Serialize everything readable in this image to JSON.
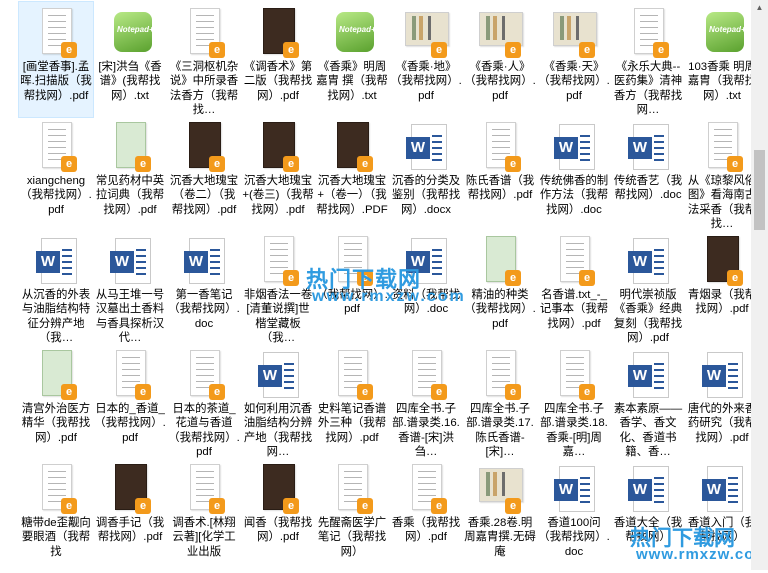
{
  "files": [
    [
      {
        "label": "[画堂香事].孟晖.扫描版（我帮找网）.pdf",
        "kind": "pdf",
        "selected": true
      },
      {
        "label": "[宋]洪刍《香谱》(我帮找网）.txt",
        "kind": "txt"
      },
      {
        "label": "《三洞枢机杂说》中所录香法香方（我帮找…",
        "kind": "pdf"
      },
      {
        "label": "《调香术》第二版（我帮找网）.pdf",
        "kind": "pdf-dark"
      },
      {
        "label": "《香乘》明周嘉胄 撰（我帮找网）.txt",
        "kind": "txt"
      },
      {
        "label": "《香乘·地》（我帮找网）.pdf",
        "kind": "pdf-book"
      },
      {
        "label": "《香乘·人》（我帮找网）.pdf",
        "kind": "pdf-book"
      },
      {
        "label": "《香乘·天》（我帮找网）.pdf",
        "kind": "pdf-book"
      },
      {
        "label": "《永乐大典--医药集》清神香方（我帮找网…",
        "kind": "pdf"
      },
      {
        "label": "103香乘 明周嘉胄（我帮找网）.txt",
        "kind": "txt"
      }
    ],
    [
      {
        "label": "xiangcheng（我帮找网）.pdf",
        "kind": "pdf"
      },
      {
        "label": "常见药材中英拉词典（我帮找网）.pdf",
        "kind": "pdf-green"
      },
      {
        "label": "沉香大地瑰宝（卷二）（我帮找网）.pdf",
        "kind": "pdf-dark"
      },
      {
        "label": "沉香大地瑰宝+(卷三)（我帮找网）.pdf",
        "kind": "pdf-dark"
      },
      {
        "label": "沉香大地瑰宝+（卷一）（我帮找网）.PDF",
        "kind": "pdf-dark"
      },
      {
        "label": "沉香的分类及鉴别（我帮找网）.docx",
        "kind": "word"
      },
      {
        "label": "陈氏香谱（我帮找网）.pdf",
        "kind": "pdf"
      },
      {
        "label": "传统佛香的制作方法（我帮找网）.doc",
        "kind": "word"
      },
      {
        "label": "传统香艺（我帮找网）.doc",
        "kind": "word"
      },
      {
        "label": "从《琼黎风俗图》看海南古法采香（我帮找…",
        "kind": "pdf"
      }
    ],
    [
      {
        "label": "从沉香的外表与油脂结构特征分辨产地（我…",
        "kind": "word"
      },
      {
        "label": "从马王堆一号汉墓出土香料与香具探析汉代…",
        "kind": "word"
      },
      {
        "label": "第一香笔记（我帮找网）.doc",
        "kind": "word"
      },
      {
        "label": "非烟香法一卷[清董说撰]世楷堂藏板（我…",
        "kind": "pdf"
      },
      {
        "label": "（我帮找网）.pdf",
        "kind": "pdf"
      },
      {
        "label": "资料（我帮找网）.doc",
        "kind": "word"
      },
      {
        "label": "精油的种类（我帮找网）.pdf",
        "kind": "pdf-green"
      },
      {
        "label": "名香谱.txt_-_记事本（我帮找网）.pdf",
        "kind": "pdf"
      },
      {
        "label": "明代崇祯版《香乘》经典复刻（我帮找网）.pdf",
        "kind": "word"
      },
      {
        "label": "青烟录（我帮找网）.pdf",
        "kind": "pdf-dark"
      }
    ],
    [
      {
        "label": "清宫外治医方精华（我帮找网）.pdf",
        "kind": "pdf-green"
      },
      {
        "label": "日本的_香道_（我帮找网）.pdf",
        "kind": "pdf"
      },
      {
        "label": "日本的茶道_花道与香道（我帮找网）.pdf",
        "kind": "pdf"
      },
      {
        "label": "如何利用沉香油脂结构分辨产地（我帮找网…",
        "kind": "word"
      },
      {
        "label": "史料笔记香谱 外三种（我帮找网）.pdf",
        "kind": "pdf"
      },
      {
        "label": "四库全书.子部.谱录类.16.香谱-[宋]洪刍…",
        "kind": "pdf"
      },
      {
        "label": "四库全书.子部.谱录类.17.陈氏香谱-[宋]…",
        "kind": "pdf"
      },
      {
        "label": "四库全书.子部.谱录类.18.香乘-[明]周嘉…",
        "kind": "pdf"
      },
      {
        "label": "素本素原——香学、香文化、香道书籍、香…",
        "kind": "word"
      },
      {
        "label": "唐代的外来香药研究（我帮找网）.pdf",
        "kind": "word"
      }
    ],
    [
      {
        "label": "糖带de歪觏向要眼酒（我帮找",
        "kind": "pdf"
      },
      {
        "label": "调香手记（我帮找网）.pdf",
        "kind": "pdf-dark"
      },
      {
        "label": "调香术.[林翔云著][化学工业出版",
        "kind": "pdf"
      },
      {
        "label": "闻香（我帮找网）.pdf",
        "kind": "pdf-dark"
      },
      {
        "label": "先醒斋医学广笔记（我帮找网）",
        "kind": "pdf"
      },
      {
        "label": "香乘（我帮找网）.pdf",
        "kind": "pdf"
      },
      {
        "label": "香乘.28卷.明周嘉胄撰.无碍庵",
        "kind": "pdf-book"
      },
      {
        "label": "香道100问（我帮找网）.doc",
        "kind": "word"
      },
      {
        "label": "香道大全（我帮找网）",
        "kind": "word"
      },
      {
        "label": "香道入门（我帮找网）",
        "kind": "word"
      }
    ]
  ],
  "watermark": {
    "title": "热门下载网",
    "url": "www.rmxzw.com"
  },
  "icons": {
    "pdf_badge": "pdf-badge-icon",
    "word": "word-doc-icon",
    "txt": "notepad-icon"
  }
}
